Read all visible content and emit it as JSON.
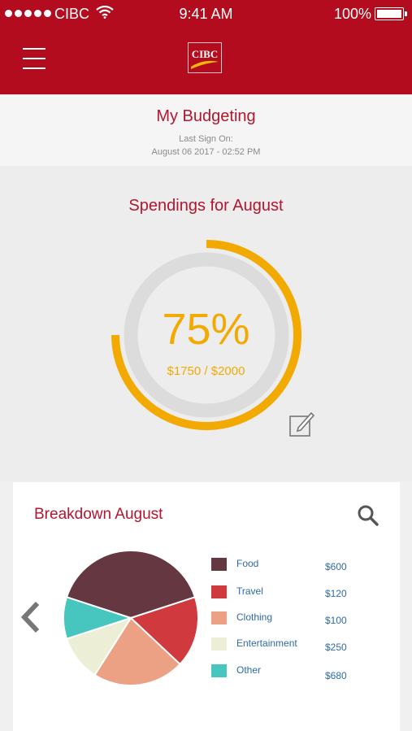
{
  "status_bar": {
    "carrier": "CIBC",
    "time": "9:41 AM",
    "battery": "100%"
  },
  "nav": {
    "logo_text": "CIBC",
    "brand_color": "#b30c1e"
  },
  "header": {
    "title": "My Budgeting",
    "last_sign_on_label": "Last Sign On:",
    "last_sign_on_value": "August 06 2017 - 02:52 PM"
  },
  "spending": {
    "title": "Spendings for August",
    "percent_text": "75%",
    "progress_fraction": 0.75,
    "amount_text": "$1750 / $2000",
    "accent_color": "#f2a900"
  },
  "breakdown": {
    "title": "Breakdown August",
    "items": [
      {
        "label": "Food",
        "value": "$600",
        "color": "#653740"
      },
      {
        "label": "Travel",
        "value": "$120",
        "color": "#d03a3f"
      },
      {
        "label": "Clothing",
        "value": "$100",
        "color": "#eca084"
      },
      {
        "label": "Entertainment",
        "value": "$250",
        "color": "#ecefd6"
      },
      {
        "label": "Other",
        "value": "$680",
        "color": "#47c6c0"
      }
    ]
  },
  "chart_data": {
    "type": "pie",
    "categories": [
      "Food",
      "Travel",
      "Clothing",
      "Entertainment",
      "Other"
    ],
    "values": [
      40,
      17,
      22,
      11,
      10
    ]
  }
}
